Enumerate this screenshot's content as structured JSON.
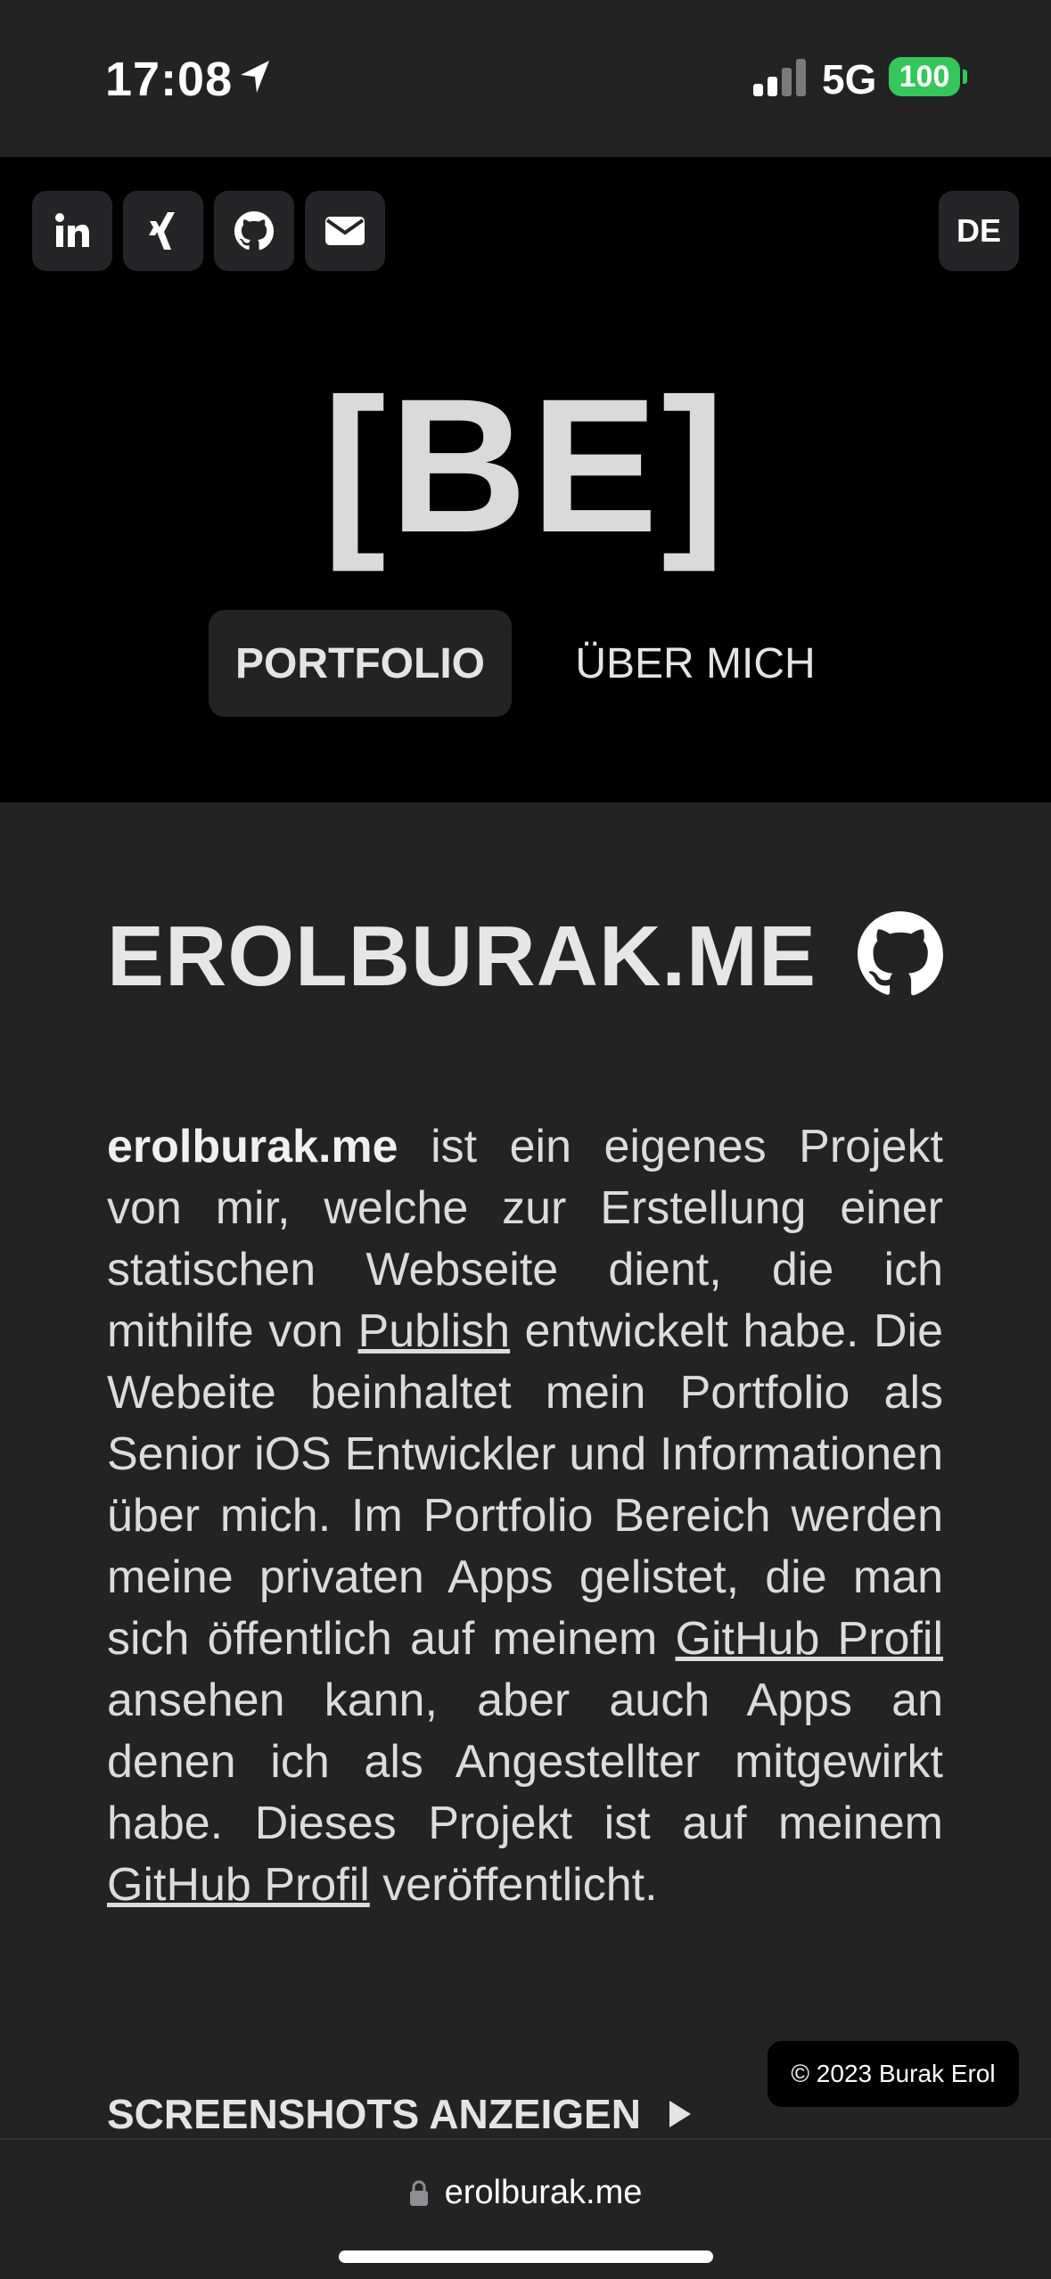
{
  "status_bar": {
    "time": "17:08",
    "network": "5G",
    "battery": "100",
    "battery_color": "#34c759"
  },
  "header": {
    "social": [
      {
        "name": "linkedin-icon",
        "label": "in"
      },
      {
        "name": "xing-icon",
        "label": "xing"
      },
      {
        "name": "github-icon",
        "label": "github"
      },
      {
        "name": "email-icon",
        "label": "email"
      }
    ],
    "language": "DE",
    "logo": "[BE]",
    "nav": {
      "portfolio": "PORTFOLIO",
      "about": "ÜBER MICH"
    }
  },
  "project": {
    "title": "EROLBURAK.ME",
    "description": {
      "name": "erolburak.me",
      "part1": " ist ein eigenes Projekt von mir, welche zur Erstellung einer statischen Webseite dient, die ich mithilfe von ",
      "link1": "Publish",
      "part2": " entwickelt habe. Die Webeite beinhaltet mein Portfolio als Senior iOS Entwickler und Informationen über mich. Im Portfolio Bereich werden meine privaten Apps gelistet, die man sich öffentlich auf meinem ",
      "link2": "GitHub Profil",
      "part3": " ansehen kann, aber auch Apps an denen ich als Angestellter mitgewirkt habe. Dieses Projekt ist auf meinem ",
      "link3": "GitHub Profil",
      "part4": " veröffentlicht."
    },
    "screenshots_label": "SCREENSHOTS ANZEIGEN"
  },
  "footer": {
    "copyright": "© 2023 Burak Erol"
  },
  "browser": {
    "url": "erolburak.me"
  }
}
